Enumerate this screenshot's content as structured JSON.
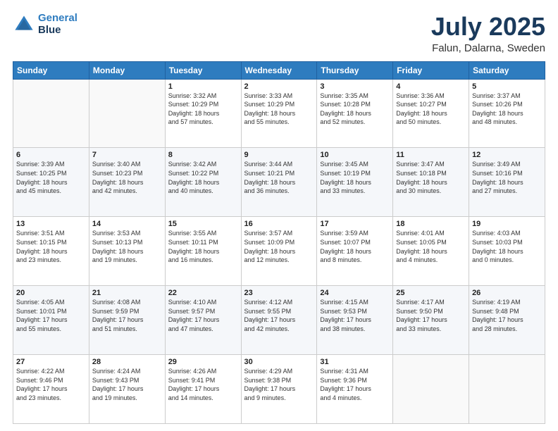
{
  "logo": {
    "line1": "General",
    "line2": "Blue"
  },
  "header": {
    "month": "July 2025",
    "location": "Falun, Dalarna, Sweden"
  },
  "weekdays": [
    "Sunday",
    "Monday",
    "Tuesday",
    "Wednesday",
    "Thursday",
    "Friday",
    "Saturday"
  ],
  "weeks": [
    [
      {
        "day": "",
        "info": ""
      },
      {
        "day": "",
        "info": ""
      },
      {
        "day": "1",
        "info": "Sunrise: 3:32 AM\nSunset: 10:29 PM\nDaylight: 18 hours\nand 57 minutes."
      },
      {
        "day": "2",
        "info": "Sunrise: 3:33 AM\nSunset: 10:29 PM\nDaylight: 18 hours\nand 55 minutes."
      },
      {
        "day": "3",
        "info": "Sunrise: 3:35 AM\nSunset: 10:28 PM\nDaylight: 18 hours\nand 52 minutes."
      },
      {
        "day": "4",
        "info": "Sunrise: 3:36 AM\nSunset: 10:27 PM\nDaylight: 18 hours\nand 50 minutes."
      },
      {
        "day": "5",
        "info": "Sunrise: 3:37 AM\nSunset: 10:26 PM\nDaylight: 18 hours\nand 48 minutes."
      }
    ],
    [
      {
        "day": "6",
        "info": "Sunrise: 3:39 AM\nSunset: 10:25 PM\nDaylight: 18 hours\nand 45 minutes."
      },
      {
        "day": "7",
        "info": "Sunrise: 3:40 AM\nSunset: 10:23 PM\nDaylight: 18 hours\nand 42 minutes."
      },
      {
        "day": "8",
        "info": "Sunrise: 3:42 AM\nSunset: 10:22 PM\nDaylight: 18 hours\nand 40 minutes."
      },
      {
        "day": "9",
        "info": "Sunrise: 3:44 AM\nSunset: 10:21 PM\nDaylight: 18 hours\nand 36 minutes."
      },
      {
        "day": "10",
        "info": "Sunrise: 3:45 AM\nSunset: 10:19 PM\nDaylight: 18 hours\nand 33 minutes."
      },
      {
        "day": "11",
        "info": "Sunrise: 3:47 AM\nSunset: 10:18 PM\nDaylight: 18 hours\nand 30 minutes."
      },
      {
        "day": "12",
        "info": "Sunrise: 3:49 AM\nSunset: 10:16 PM\nDaylight: 18 hours\nand 27 minutes."
      }
    ],
    [
      {
        "day": "13",
        "info": "Sunrise: 3:51 AM\nSunset: 10:15 PM\nDaylight: 18 hours\nand 23 minutes."
      },
      {
        "day": "14",
        "info": "Sunrise: 3:53 AM\nSunset: 10:13 PM\nDaylight: 18 hours\nand 19 minutes."
      },
      {
        "day": "15",
        "info": "Sunrise: 3:55 AM\nSunset: 10:11 PM\nDaylight: 18 hours\nand 16 minutes."
      },
      {
        "day": "16",
        "info": "Sunrise: 3:57 AM\nSunset: 10:09 PM\nDaylight: 18 hours\nand 12 minutes."
      },
      {
        "day": "17",
        "info": "Sunrise: 3:59 AM\nSunset: 10:07 PM\nDaylight: 18 hours\nand 8 minutes."
      },
      {
        "day": "18",
        "info": "Sunrise: 4:01 AM\nSunset: 10:05 PM\nDaylight: 18 hours\nand 4 minutes."
      },
      {
        "day": "19",
        "info": "Sunrise: 4:03 AM\nSunset: 10:03 PM\nDaylight: 18 hours\nand 0 minutes."
      }
    ],
    [
      {
        "day": "20",
        "info": "Sunrise: 4:05 AM\nSunset: 10:01 PM\nDaylight: 17 hours\nand 55 minutes."
      },
      {
        "day": "21",
        "info": "Sunrise: 4:08 AM\nSunset: 9:59 PM\nDaylight: 17 hours\nand 51 minutes."
      },
      {
        "day": "22",
        "info": "Sunrise: 4:10 AM\nSunset: 9:57 PM\nDaylight: 17 hours\nand 47 minutes."
      },
      {
        "day": "23",
        "info": "Sunrise: 4:12 AM\nSunset: 9:55 PM\nDaylight: 17 hours\nand 42 minutes."
      },
      {
        "day": "24",
        "info": "Sunrise: 4:15 AM\nSunset: 9:53 PM\nDaylight: 17 hours\nand 38 minutes."
      },
      {
        "day": "25",
        "info": "Sunrise: 4:17 AM\nSunset: 9:50 PM\nDaylight: 17 hours\nand 33 minutes."
      },
      {
        "day": "26",
        "info": "Sunrise: 4:19 AM\nSunset: 9:48 PM\nDaylight: 17 hours\nand 28 minutes."
      }
    ],
    [
      {
        "day": "27",
        "info": "Sunrise: 4:22 AM\nSunset: 9:46 PM\nDaylight: 17 hours\nand 23 minutes."
      },
      {
        "day": "28",
        "info": "Sunrise: 4:24 AM\nSunset: 9:43 PM\nDaylight: 17 hours\nand 19 minutes."
      },
      {
        "day": "29",
        "info": "Sunrise: 4:26 AM\nSunset: 9:41 PM\nDaylight: 17 hours\nand 14 minutes."
      },
      {
        "day": "30",
        "info": "Sunrise: 4:29 AM\nSunset: 9:38 PM\nDaylight: 17 hours\nand 9 minutes."
      },
      {
        "day": "31",
        "info": "Sunrise: 4:31 AM\nSunset: 9:36 PM\nDaylight: 17 hours\nand 4 minutes."
      },
      {
        "day": "",
        "info": ""
      },
      {
        "day": "",
        "info": ""
      }
    ]
  ]
}
